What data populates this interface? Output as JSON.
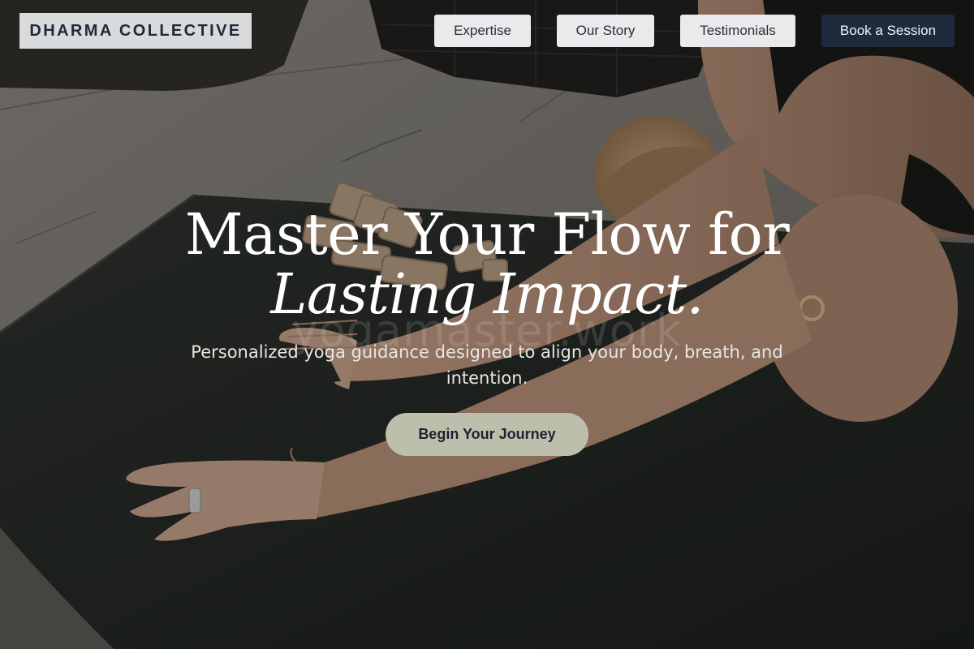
{
  "brand": {
    "logo_text": "DHARMA COLLECTIVE"
  },
  "nav": {
    "items": [
      {
        "label": "Expertise"
      },
      {
        "label": "Our Story"
      },
      {
        "label": "Testimonials"
      },
      {
        "label": "Book a Session"
      }
    ]
  },
  "hero": {
    "headline_line1": "Master Your Flow for",
    "headline_line2": "Lasting Impact.",
    "watermark_text": "yogamaster.work",
    "subtitle": "Personalized yoga guidance designed to align your body, breath, and intention.",
    "cta_label": "Begin Your Journey"
  },
  "colors": {
    "logo_bg": "#d9dadb",
    "nav_button_bg": "#e9eaeb",
    "nav_primary_bg": "#1f2a3d",
    "cta_bg": "#bdbfac",
    "headline": "#ffffff"
  }
}
